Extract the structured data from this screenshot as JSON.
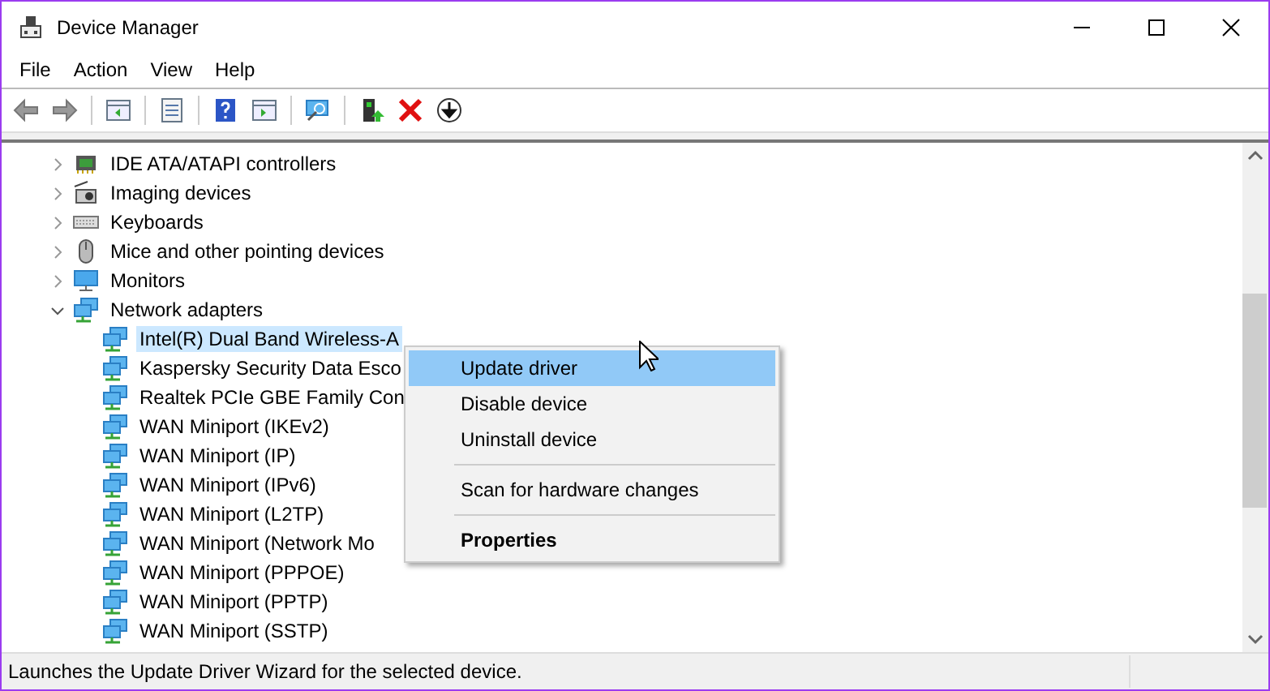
{
  "window": {
    "title": "Device Manager"
  },
  "menu_bar": [
    "File",
    "Action",
    "View",
    "Help"
  ],
  "tree": [
    {
      "label": "IDE ATA/ATAPI controllers",
      "kind": "ide",
      "expanded": false,
      "selected": false
    },
    {
      "label": "Imaging devices",
      "kind": "imaging",
      "expanded": false,
      "selected": false
    },
    {
      "label": "Keyboards",
      "kind": "keyboard",
      "expanded": false,
      "selected": false
    },
    {
      "label": "Mice and other pointing devices",
      "kind": "mouse",
      "expanded": false,
      "selected": false
    },
    {
      "label": "Monitors",
      "kind": "monitor",
      "expanded": false,
      "selected": false
    },
    {
      "label": "Network adapters",
      "kind": "network",
      "expanded": true,
      "selected": false,
      "children": [
        {
          "label": "Intel(R) Dual Band Wireless-A",
          "kind": "network",
          "selected": true
        },
        {
          "label": "Kaspersky Security Data Esco",
          "kind": "network",
          "selected": false
        },
        {
          "label": "Realtek PCIe GBE Family Con",
          "kind": "network",
          "selected": false
        },
        {
          "label": "WAN Miniport (IKEv2)",
          "kind": "network",
          "selected": false
        },
        {
          "label": "WAN Miniport (IP)",
          "kind": "network",
          "selected": false
        },
        {
          "label": "WAN Miniport (IPv6)",
          "kind": "network",
          "selected": false
        },
        {
          "label": "WAN Miniport (L2TP)",
          "kind": "network",
          "selected": false
        },
        {
          "label": "WAN Miniport (Network Mo",
          "kind": "network",
          "selected": false
        },
        {
          "label": "WAN Miniport (PPPOE)",
          "kind": "network",
          "selected": false
        },
        {
          "label": "WAN Miniport (PPTP)",
          "kind": "network",
          "selected": false
        },
        {
          "label": "WAN Miniport (SSTP)",
          "kind": "network",
          "selected": false
        }
      ]
    }
  ],
  "context_menu": [
    {
      "kind": "item",
      "label": "Update driver",
      "selected": true,
      "default": false
    },
    {
      "kind": "item",
      "label": "Disable device",
      "selected": false,
      "default": false
    },
    {
      "kind": "item",
      "label": "Uninstall device",
      "selected": false,
      "default": false
    },
    {
      "kind": "separator"
    },
    {
      "kind": "item",
      "label": "Scan for hardware changes",
      "selected": false,
      "default": false
    },
    {
      "kind": "separator"
    },
    {
      "kind": "item",
      "label": "Properties",
      "selected": false,
      "default": true
    }
  ],
  "status_bar": {
    "text": "Launches the Update Driver Wizard for the selected device."
  }
}
